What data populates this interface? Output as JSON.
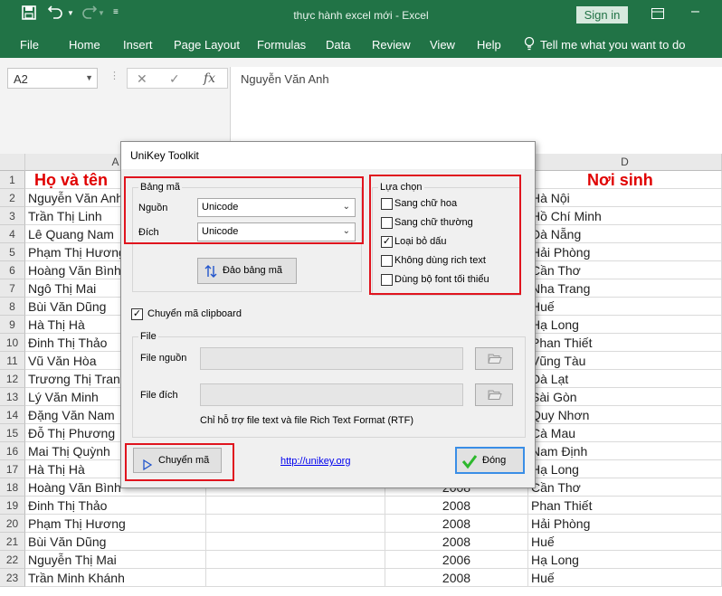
{
  "window": {
    "title": "thực hành excel mới  -  Excel",
    "sign_in": "Sign in"
  },
  "ribbon": {
    "tabs": [
      "File",
      "Home",
      "Insert",
      "Page Layout",
      "Formulas",
      "Data",
      "Review",
      "View",
      "Help"
    ],
    "tell_me": "Tell me what you want to do"
  },
  "formula_bar": {
    "name_box": "A2",
    "value": "Nguyễn Văn Anh",
    "fx": "fx"
  },
  "columns": [
    "A",
    "D"
  ],
  "rows": [
    {
      "n": "1",
      "name": "Họ và tên",
      "year": "",
      "place": "Nơi sinh"
    },
    {
      "n": "2",
      "name": "Nguyễn Văn Anh",
      "year": "",
      "place": "Hà Nội"
    },
    {
      "n": "3",
      "name": "Trần Thị Linh",
      "year": "",
      "place": "Hồ Chí Minh"
    },
    {
      "n": "4",
      "name": "Lê Quang Nam",
      "year": "",
      "place": "Đà Nẵng"
    },
    {
      "n": "5",
      "name": "Phạm Thị Hương",
      "year": "",
      "place": "Hải Phòng"
    },
    {
      "n": "6",
      "name": "Hoàng Văn Bình",
      "year": "",
      "place": "Cần Thơ"
    },
    {
      "n": "7",
      "name": "Ngô Thị Mai",
      "year": "",
      "place": "Nha Trang"
    },
    {
      "n": "8",
      "name": "Bùi Văn Dũng",
      "year": "",
      "place": "Huế"
    },
    {
      "n": "9",
      "name": "Hà Thị Hà",
      "year": "",
      "place": "Hạ Long"
    },
    {
      "n": "10",
      "name": "Đinh Thị Thảo",
      "year": "",
      "place": "Phan Thiết"
    },
    {
      "n": "11",
      "name": "Vũ Văn Hòa",
      "year": "",
      "place": "Vũng Tàu"
    },
    {
      "n": "12",
      "name": "Trương Thị Trang",
      "year": "",
      "place": "Đà Lạt"
    },
    {
      "n": "13",
      "name": "Lý Văn Minh",
      "year": "",
      "place": "Sài Gòn"
    },
    {
      "n": "14",
      "name": "Đặng Văn Nam",
      "year": "",
      "place": "Quy Nhơn"
    },
    {
      "n": "15",
      "name": "Đỗ Thị Phương",
      "year": "",
      "place": "Cà Mau"
    },
    {
      "n": "16",
      "name": "Mai Thị Quỳnh",
      "year": "",
      "place": "Nam Định"
    },
    {
      "n": "17",
      "name": "Hà Thị Hà",
      "year": "",
      "place": "Hạ Long"
    },
    {
      "n": "18",
      "name": "Hoàng Văn Bình",
      "year": "2008",
      "place": "Cần Thơ"
    },
    {
      "n": "19",
      "name": "Đinh Thị Thảo",
      "year": "2008",
      "place": "Phan Thiết"
    },
    {
      "n": "20",
      "name": "Phạm Thị Hương",
      "year": "2008",
      "place": "Hải Phòng"
    },
    {
      "n": "21",
      "name": "Bùi Văn Dũng",
      "year": "2008",
      "place": "Huế"
    },
    {
      "n": "22",
      "name": "Nguyễn Thị Mai",
      "year": "2006",
      "place": "Hạ Long"
    },
    {
      "n": "23",
      "name": "Trần Minh Khánh",
      "year": "2008",
      "place": "Huế"
    }
  ],
  "dialog": {
    "title": "UniKey Toolkit",
    "encoding_group": "Bảng mã",
    "source_label": "Nguồn",
    "source_value": "Unicode",
    "dest_label": "Đích",
    "dest_value": "Unicode",
    "swap_button": "Đảo bảng mã",
    "options_group": "Lựa chọn",
    "options": [
      {
        "label": "Sang chữ hoa",
        "checked": false
      },
      {
        "label": "Sang chữ thường",
        "checked": false
      },
      {
        "label": "Loại bỏ dấu",
        "checked": true
      },
      {
        "label": "Không dùng rich text",
        "checked": false
      },
      {
        "label": "Dùng bộ font tối thiểu",
        "checked": false
      }
    ],
    "clipboard_label": "Chuyển mã clipboard",
    "clipboard_checked": true,
    "file_group": "File",
    "file_source_label": "File nguồn",
    "file_dest_label": "File đích",
    "file_note": "Chỉ hỗ trợ file text và file Rich Text Format (RTF)",
    "convert_button": "Chuyển mã",
    "link": "http://unikey.org",
    "close_button": "Đóng"
  },
  "colors": {
    "excel_green": "#217346",
    "highlight_red": "#e0141e",
    "header_text": "#e00000"
  }
}
